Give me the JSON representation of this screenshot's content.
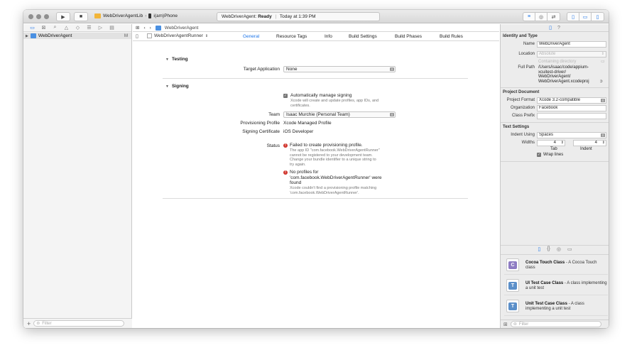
{
  "toolbar": {
    "run_icon": "play-icon",
    "stop_icon": "stop-icon",
    "scheme": "WebDriverAgentLib",
    "separator": "›",
    "device": "i(am)Phone",
    "status_app": "WebDriverAgent:",
    "status_state": "Ready",
    "status_divider": "|",
    "status_time": "Today at 1:39 PM"
  },
  "navigator": {
    "tree_item": "WebDriverAgent",
    "tree_badge": "M",
    "filter_placeholder": "Filter",
    "add_glyph": "+"
  },
  "editor": {
    "breadcrumb": "WebDriverAgent",
    "target": "WebDriverAgentRunner",
    "target_arrows": "⌃",
    "tabs": [
      "General",
      "Resource Tags",
      "Info",
      "Build Settings",
      "Build Phases",
      "Build Rules"
    ],
    "testing": {
      "title": "Testing",
      "target_application_label": "Target Application",
      "target_application_value": "None"
    },
    "signing": {
      "title": "Signing",
      "auto_label": "Automatically manage signing",
      "auto_note": [
        "Xcode will create and update profiles, app IDs, and",
        "certificates."
      ],
      "team_label": "Team",
      "team_value": "Isaac Murchie (Personal Team)",
      "profile_label": "Provisioning Profile",
      "profile_value": "Xcode Managed Profile",
      "cert_label": "Signing Certificate",
      "cert_value": "iOS Developer",
      "status_label": "Status",
      "error1_title": "Failed to create provisioning profile.",
      "error1_note": [
        "The app ID \"com.facebook.WebDriverAgentRunner\"",
        "cannot be registered to your development team.",
        "Change your bundle identifier to a unique string to",
        "try again."
      ],
      "error2_title": [
        "No profiles for",
        "'com.facebook.WebDriverAgentRunner' were",
        "found"
      ],
      "error2_note": [
        "Xcode couldn't find a provisioning profile matching",
        "'com.facebook.WebDriverAgentRunner'."
      ]
    }
  },
  "inspector": {
    "identity_title": "Identity and Type",
    "name_label": "Name",
    "name_value": "WebDriverAgent",
    "location_label": "Location",
    "location_value": "Absolute",
    "containing_value": "Containing directory",
    "fullpath_label": "Full Path",
    "fullpath_value": [
      "/Users/isaac/code/appium-",
      "xcuitest-driver/",
      "WebDriverAgent/",
      "WebDriverAgent.xcodeproj"
    ],
    "project_doc_title": "Project Document",
    "format_label": "Project Format",
    "format_value": "Xcode 3.2-compatible",
    "org_label": "Organization",
    "org_value": "Facebook",
    "prefix_label": "Class Prefix",
    "prefix_value": "",
    "text_settings_title": "Text Settings",
    "indent_label": "Indent Using",
    "indent_value": "Spaces",
    "widths_label": "Widths",
    "tab_width": "4",
    "indent_width": "4",
    "tab_caption": "Tab",
    "indent_caption": "Indent",
    "wrap_label": "Wrap lines",
    "library": [
      {
        "title": "Cocoa Touch Class",
        "desc": " - A Cocoa Touch class",
        "glyph": "C",
        "color": "#8e7cc3"
      },
      {
        "title": "UI Test Case Class",
        "desc": " - A class implementing a unit test",
        "glyph": "T",
        "color": "#5b8fc9"
      },
      {
        "title": "Unit Test Case Class",
        "desc": " - A class implementing a unit test",
        "glyph": "T",
        "color": "#5b8fc9"
      }
    ],
    "filter_placeholder": "Filter"
  }
}
